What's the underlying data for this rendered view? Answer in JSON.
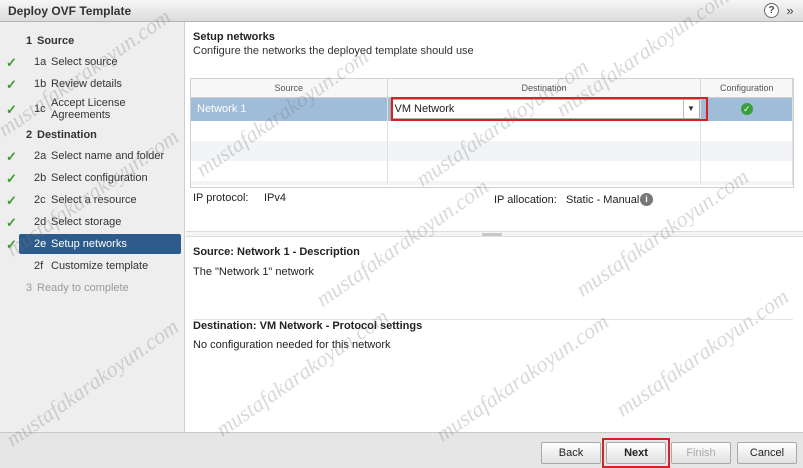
{
  "window": {
    "title": "Deploy OVF Template"
  },
  "sidebar": {
    "steps": [
      {
        "num": "1",
        "label": "Source"
      },
      {
        "num": "1a",
        "label": "Select source"
      },
      {
        "num": "1b",
        "label": "Review details"
      },
      {
        "num": "1c",
        "label": "Accept License Agreements"
      },
      {
        "num": "2",
        "label": "Destination"
      },
      {
        "num": "2a",
        "label": "Select name and folder"
      },
      {
        "num": "2b",
        "label": "Select configuration"
      },
      {
        "num": "2c",
        "label": "Select a resource"
      },
      {
        "num": "2d",
        "label": "Select storage"
      },
      {
        "num": "2e",
        "label": "Setup networks"
      },
      {
        "num": "2f",
        "label": "Customize template"
      },
      {
        "num": "3",
        "label": "Ready to complete"
      }
    ],
    "check_color": "#3c9a2e",
    "selected_color": "#2d5c8c"
  },
  "main": {
    "title": "Setup networks",
    "subtitle": "Configure the networks the deployed template should use",
    "table": {
      "headers": [
        "Source",
        "Destination",
        "Configuration"
      ],
      "rows": [
        {
          "source": "Network 1",
          "destination": "VM Network",
          "configuration": "ok"
        }
      ]
    },
    "ip_protocol_label": "IP protocol:",
    "ip_protocol_value": "IPv4",
    "ip_allocation_label": "IP allocation:",
    "ip_allocation_value": "Static - Manual",
    "description_title": "Source: Network 1 - Description",
    "description_text": "The \"Network 1\" network",
    "protocol_title": "Destination: VM Network - Protocol settings",
    "protocol_text": "No configuration needed for this network"
  },
  "footer": {
    "back": "Back",
    "next": "Next",
    "finish": "Finish",
    "cancel": "Cancel"
  },
  "watermark": "mustafakarakoyun.com",
  "highlight_color": "#d42121"
}
